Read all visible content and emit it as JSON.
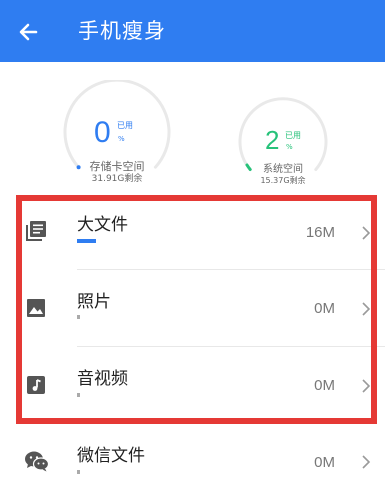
{
  "appbar": {
    "title": "手机瘦身",
    "back_icon": "arrow-left-icon"
  },
  "colors": {
    "primary": "#2f7df1",
    "system_green": "#27c27a",
    "highlight_red": "#e53935"
  },
  "storage": {
    "sd_card": {
      "value": "0",
      "used_label": "已用",
      "unit": "%",
      "label": "存储卡空间",
      "free": "31.91G剩余",
      "percent_used": 0
    },
    "system": {
      "value": "2",
      "used_label": "已用",
      "unit": "%",
      "label": "系统空间",
      "free": "15.37G剩余",
      "percent_used": 2
    }
  },
  "categories": [
    {
      "label": "大文件",
      "size": "16M",
      "icon": "document-list-icon",
      "usage_fraction": 0.05
    },
    {
      "label": "照片",
      "size": "0M",
      "icon": "image-icon",
      "usage_fraction": 0
    },
    {
      "label": "音视频",
      "size": "0M",
      "icon": "music-note-icon",
      "usage_fraction": 0
    },
    {
      "label": "微信文件",
      "size": "0M",
      "icon": "wechat-icon",
      "usage_fraction": 0
    }
  ]
}
